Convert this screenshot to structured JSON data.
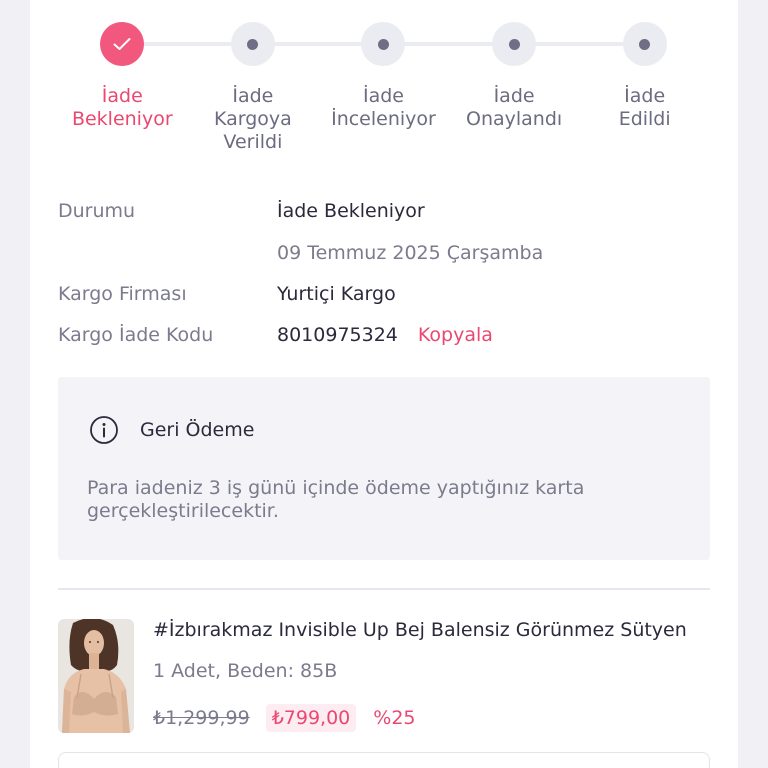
{
  "colors": {
    "accent": "#ea4870",
    "accent_fill": "#f2577e",
    "badge_bg": "#fdecf1",
    "text_dark": "#2a2a3c",
    "text_muted": "#7b7b8e",
    "step_label": "#6c6c80",
    "step_inactive": "#ebebf2",
    "step_dot": "#6e6e84",
    "page_bg": "#f1f1f5",
    "info_box_bg": "#f4f4f8"
  },
  "stepper": {
    "steps": [
      {
        "lines": [
          "İade",
          "Bekleniyor"
        ],
        "completed": true,
        "icon": "check-icon"
      },
      {
        "lines": [
          "İade",
          "Kargoya",
          "Verildi"
        ],
        "completed": false,
        "icon": "dot-icon"
      },
      {
        "lines": [
          "İade",
          "İnceleniyor"
        ],
        "completed": false,
        "icon": "dot-icon"
      },
      {
        "lines": [
          "İade",
          "Onaylandı"
        ],
        "completed": false,
        "icon": "dot-icon"
      },
      {
        "lines": [
          "İade",
          "Edildi"
        ],
        "completed": false,
        "icon": "dot-icon"
      }
    ]
  },
  "details": {
    "status": {
      "label": "Durumu",
      "value": "İade Bekleniyor",
      "date": "09 Temmuz 2025 Çarşamba"
    },
    "carrier": {
      "label": "Kargo Firması",
      "value": "Yurtiçi Kargo"
    },
    "return_code": {
      "label": "Kargo İade Kodu",
      "value": "8010975324",
      "copy_label": "Kopyala"
    }
  },
  "refund": {
    "icon": "info-icon",
    "title": "Geri Ödeme",
    "text": "Para iadeniz 3 iş günü içinde ödeme yaptığınız karta gerçekleştirilecektir."
  },
  "product": {
    "name": "#İzbırakmaz Invisible Up Bej Balensiz Görünmez Sütyen",
    "quantity_size": "1 Adet, Beden: 85B",
    "original_price": "₺1,299,99",
    "price": "₺799,00",
    "discount": "%25"
  }
}
